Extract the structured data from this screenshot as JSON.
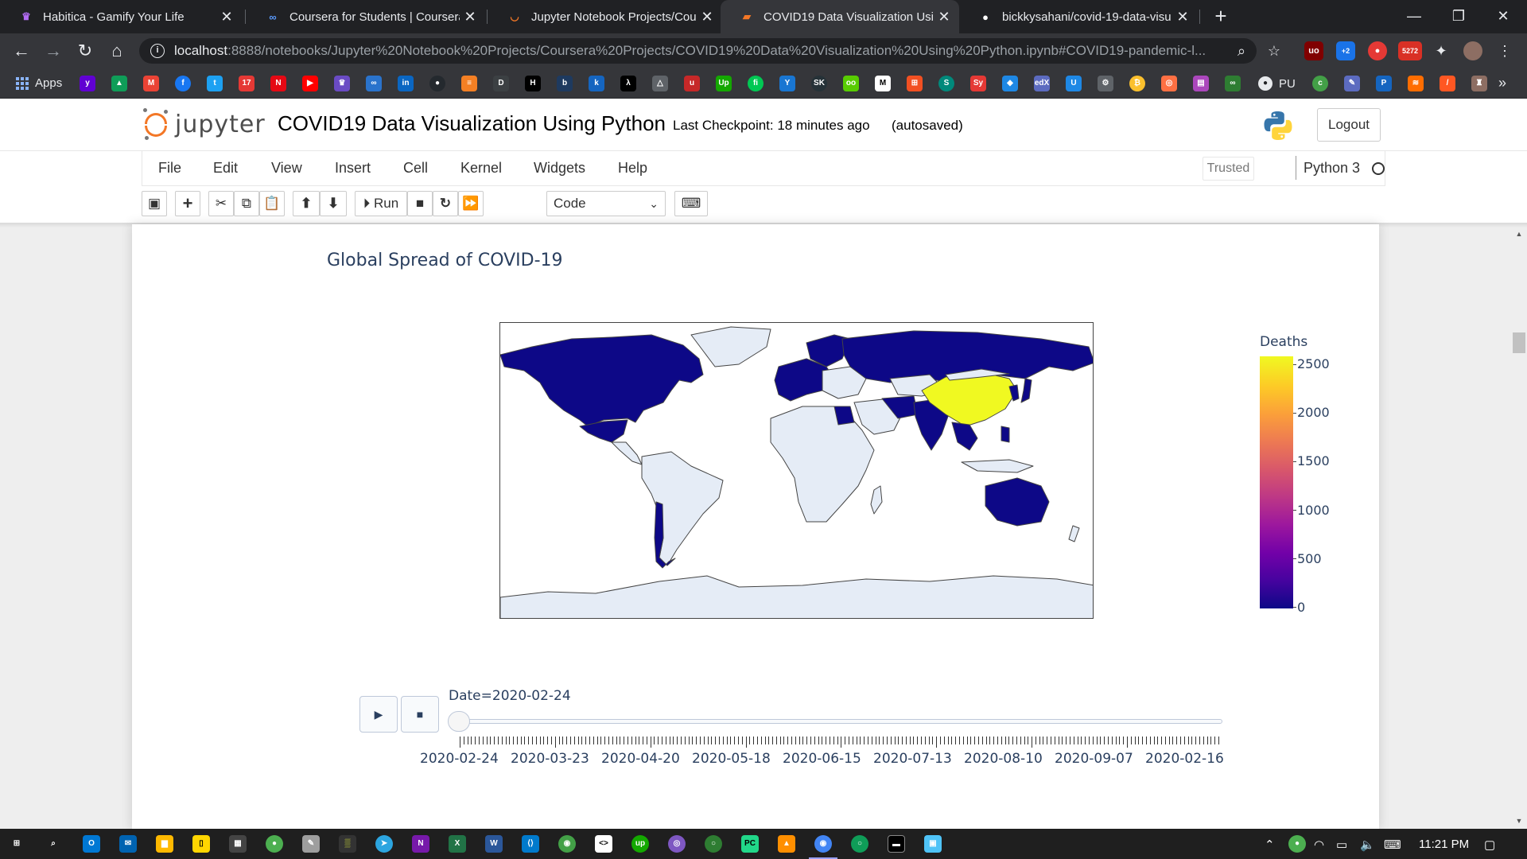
{
  "browser": {
    "tabs": [
      {
        "title": "Habitica - Gamify Your Life",
        "icon": "habitica-icon",
        "active": false
      },
      {
        "title": "Coursera for Students | Coursera",
        "icon": "coursera-icon",
        "active": false
      },
      {
        "title": "Jupyter Notebook Projects/Cours",
        "icon": "jupyter-icon",
        "active": false
      },
      {
        "title": "COVID19 Data Visualization Usin",
        "icon": "notebook-icon",
        "active": true
      },
      {
        "title": "bickkysahani/covid-19-data-visu",
        "icon": "github-icon",
        "active": false
      }
    ],
    "new_tab": "+",
    "url_host": "localhost",
    "url_path": ":8888/notebooks/Jupyter%20Notebook%20Projects/Coursera%20Projects/COVID19%20Data%20Visualization%20Using%20Python.ipynb#COVID19-pandemic-l...",
    "extension_badges": {
      "plus": "+2",
      "mail": "5272"
    }
  },
  "bookmarks": {
    "apps_label": "Apps",
    "pu_label": "PU",
    "more": "»"
  },
  "jupyter": {
    "logo_text": "jupyter",
    "notebook_title": "COVID19 Data Visualization Using Python",
    "checkpoint": "Last Checkpoint: 18 minutes ago",
    "autosave_status": "(autosaved)",
    "logout_label": "Logout",
    "menu": [
      "File",
      "Edit",
      "View",
      "Insert",
      "Cell",
      "Kernel",
      "Widgets",
      "Help"
    ],
    "trusted_label": "Trusted",
    "kernel_name": "Python 3",
    "run_label": "Run",
    "cell_type": "Code"
  },
  "plot": {
    "title": "Global Spread of COVID-19",
    "colorbar_title": "Deaths",
    "colorbar_ticks": [
      "2500",
      "2000",
      "1500",
      "1000",
      "500",
      "0"
    ],
    "colorscale": [
      "#0d0887",
      "#46039f",
      "#7201a8",
      "#9c179e",
      "#bd3786",
      "#d8576b",
      "#ed7953",
      "#fb9f3a",
      "#fdca26",
      "#f0f921"
    ],
    "land_color": "#e5ecf6",
    "slider_label": "Date=2020-02-24",
    "slider_dates": [
      "2020-02-24",
      "2020-03-23",
      "2020-04-20",
      "2020-05-18",
      "2020-06-15",
      "2020-07-13",
      "2020-08-10",
      "2020-09-07",
      "2020-02-16"
    ]
  },
  "taskbar": {
    "time": "11:21 PM"
  }
}
